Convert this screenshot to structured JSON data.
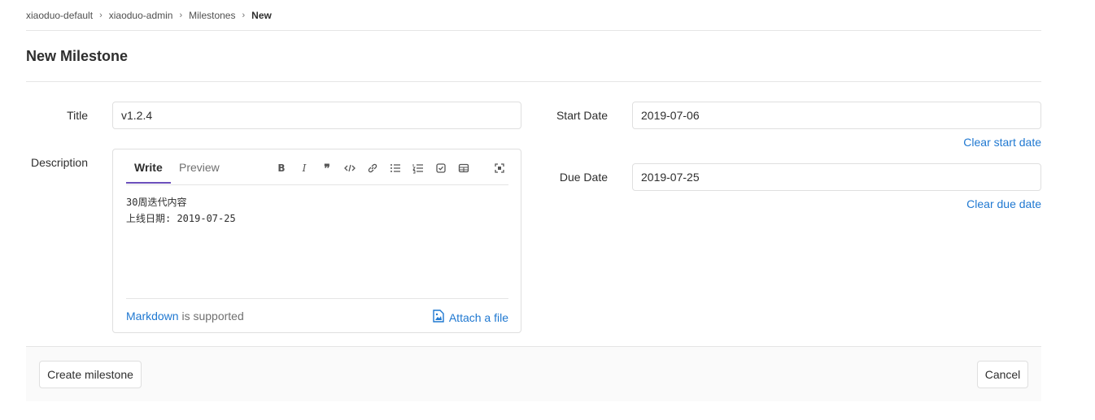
{
  "breadcrumb": {
    "items": [
      "xiaoduo-default",
      "xiaoduo-admin",
      "Milestones",
      "New"
    ]
  },
  "page_title": "New Milestone",
  "form": {
    "title_label": "Title",
    "title_value": "v1.2.4",
    "description_label": "Description",
    "start_date_label": "Start Date",
    "start_date_value": "2019-07-06",
    "clear_start_label": "Clear start date",
    "due_date_label": "Due Date",
    "due_date_value": "2019-07-25",
    "clear_due_label": "Clear due date"
  },
  "editor": {
    "tabs": [
      "Write",
      "Preview"
    ],
    "active_tab": "Write",
    "toolbar_icons": [
      "bold-icon",
      "italic-icon",
      "quote-icon",
      "code-icon",
      "link-icon",
      "bullet-list-icon",
      "numbered-list-icon",
      "task-list-icon",
      "table-icon",
      "fullscreen-icon"
    ],
    "content_line1": "30周迭代内容",
    "content_line2": "上线日期: 2019-07-25",
    "markdown_link": "Markdown",
    "markdown_suffix": "is supported",
    "attach_label": "Attach a file"
  },
  "actions": {
    "create_label": "Create milestone",
    "cancel_label": "Cancel"
  },
  "colors": {
    "accent": "#1f78d1",
    "tab_underline": "#6b4fbb"
  }
}
